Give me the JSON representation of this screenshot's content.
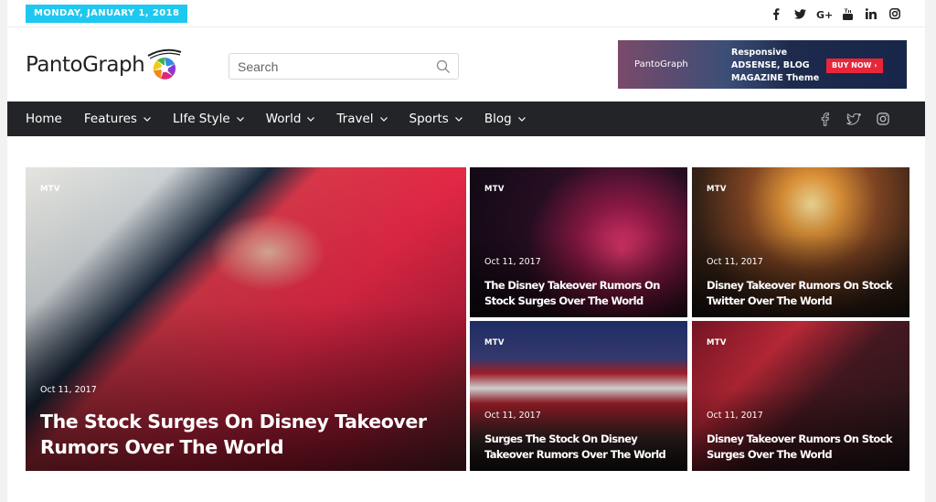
{
  "topbar": {
    "date": "MONDAY, JANUARY 1, 2018",
    "social": [
      "facebook-icon",
      "twitter-icon",
      "google-plus-icon",
      "youtube-icon",
      "linkedin-icon",
      "instagram-icon"
    ]
  },
  "header": {
    "logo_text": "PantoGraph",
    "search": {
      "placeholder": "Search",
      "value": ""
    },
    "ad": {
      "logo_text": "PantoGraph",
      "line1": "Responsive",
      "line2": "ADSENSE, BLOG",
      "line3": "MAGAZINE Theme",
      "button": "BUY NOW ›"
    }
  },
  "nav": {
    "items": [
      {
        "label": "Home",
        "dropdown": false
      },
      {
        "label": "Features",
        "dropdown": true
      },
      {
        "label": "LIfe Style",
        "dropdown": true
      },
      {
        "label": "World",
        "dropdown": true
      },
      {
        "label": "Travel",
        "dropdown": true
      },
      {
        "label": "Sports",
        "dropdown": true
      },
      {
        "label": "Blog",
        "dropdown": true
      }
    ],
    "social": [
      "facebook-icon",
      "twitter-icon",
      "instagram-icon"
    ]
  },
  "posts": {
    "featured": {
      "category": "MTV",
      "date": "Oct 11, 2017",
      "title": "The Stock Surges On Disney Takeover Rumors Over The World"
    },
    "items": [
      {
        "category": "MTV",
        "date": "Oct 11, 2017",
        "title": "The Disney Takeover Rumors On Stock Surges Over The World"
      },
      {
        "category": "MTV",
        "date": "Oct 11, 2017",
        "title": "Disney Takeover Rumors On Stock Twitter Over The World"
      },
      {
        "category": "MTV",
        "date": "Oct 11, 2017",
        "title": "Surges The Stock On Disney Takeover Rumors Over The World"
      },
      {
        "category": "MTV",
        "date": "Oct 11, 2017",
        "title": "Disney Takeover Rumors On Stock Surges Over The World"
      }
    ]
  },
  "colors": {
    "accent": "#1ec8f0",
    "nav_bg": "#222428",
    "ad_button": "#e8263a"
  }
}
